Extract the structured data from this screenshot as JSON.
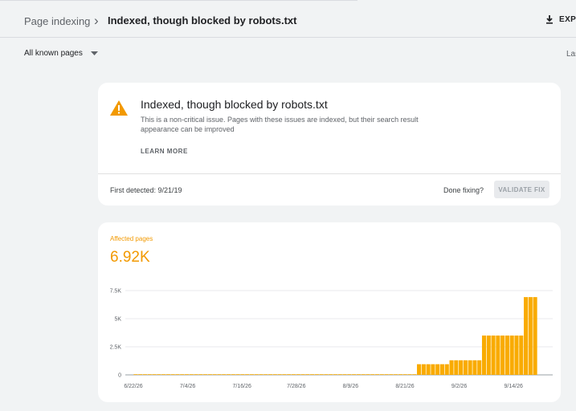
{
  "header": {
    "breadcrumb_parent": "Page indexing",
    "breadcrumb_separator": "›",
    "breadcrumb_current": "Indexed, though blocked by robots.txt",
    "export_label": "EXPO"
  },
  "filter": {
    "selected": "All known pages",
    "last_updated_label": "Las"
  },
  "issue": {
    "title": "Indexed, though blocked by robots.txt",
    "description": "This is a non-critical issue. Pages with these issues are indexed, but their search result appearance can be improved",
    "learn_more": "LEARN MORE",
    "first_detected": "First detected: 9/21/19",
    "done_fixing": "Done fixing?",
    "validate_fix": "VALIDATE FIX",
    "warning_color": "#f29900"
  },
  "metric": {
    "label": "Affected pages",
    "value": "6.92K",
    "color": "#f29900"
  },
  "chart_data": {
    "type": "bar",
    "bar_color": "#f9ab00",
    "x_tick_labels": [
      "6/22/26",
      "7/4/26",
      "7/16/26",
      "7/28/26",
      "8/9/26",
      "8/21/26",
      "9/2/26",
      "9/14/26"
    ],
    "y_tick_labels": [
      "0",
      "2.5K",
      "5K",
      "7.5K"
    ],
    "y_ticks": [
      0,
      2500,
      5000,
      7500
    ],
    "ylim": [
      0,
      7500
    ],
    "grid": true,
    "series": [
      {
        "values": [
          10,
          10,
          10,
          10,
          10,
          10,
          10,
          10,
          10,
          10,
          10,
          10,
          10,
          10,
          10,
          10,
          10,
          10,
          10,
          10,
          10,
          10,
          10,
          10,
          10,
          10,
          10,
          10,
          10,
          10,
          10,
          10,
          10,
          10,
          10,
          10,
          10,
          10,
          10,
          10,
          10,
          10,
          10,
          10,
          10,
          10,
          10,
          10,
          10,
          10,
          10,
          10,
          10,
          10,
          10,
          10,
          10,
          10,
          10,
          10,
          10,
          950,
          950,
          950,
          950,
          950,
          950,
          950,
          1300,
          1300,
          1300,
          1300,
          1300,
          1300,
          1300,
          3500,
          3500,
          3500,
          3500,
          3500,
          3500,
          3500,
          3500,
          3500,
          6920,
          6920,
          6920
        ]
      }
    ]
  }
}
